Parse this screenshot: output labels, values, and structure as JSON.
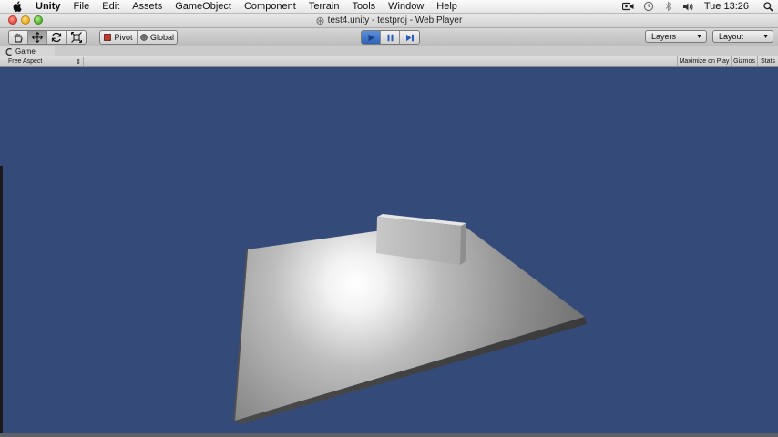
{
  "menubar": {
    "app": "Unity",
    "items": [
      "File",
      "Edit",
      "Assets",
      "GameObject",
      "Component",
      "Terrain",
      "Tools",
      "Window",
      "Help"
    ],
    "clock": "Tue 13:26",
    "icons": [
      "apple-icon",
      "camera-icon",
      "time-machine-icon",
      "bluetooth-icon",
      "volume-icon",
      "spotlight-search-icon"
    ]
  },
  "window": {
    "title": "test4.unity - testproj - Web Player"
  },
  "toolbar": {
    "pivot_label": "Pivot",
    "global_label": "Global",
    "layers_label": "Layers",
    "layout_label": "Layout",
    "tools": [
      "hand-tool-icon",
      "move-tool-icon",
      "rotate-tool-icon",
      "scale-tool-icon"
    ],
    "playback": [
      "play-icon",
      "pause-icon",
      "step-icon"
    ]
  },
  "game_view": {
    "tab_label": "Game",
    "aspect_label": "Free Aspect",
    "maximize_label": "Maximize on Play",
    "gizmos_label": "Gizmos",
    "stats_label": "Stats",
    "background_color": "#344b7a"
  },
  "colors": {
    "play_active": "#3a6fc4",
    "scene_background": "#344b7a"
  }
}
